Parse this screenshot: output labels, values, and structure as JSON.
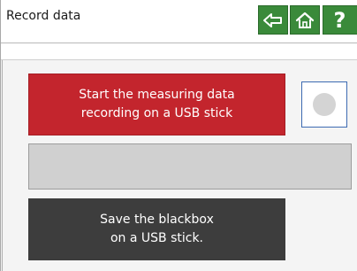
{
  "header": {
    "title": "Record data",
    "back_icon": "arrow-left-icon",
    "home_icon": "home-icon",
    "help_label": "?"
  },
  "actions": {
    "record_label": "Start the measuring data\nrecording on a USB stick",
    "blackbox_label": "Save the blackbox\non a USB stick."
  },
  "colors": {
    "nav_green": "#3a8a3a",
    "record_red": "#c3252d",
    "blackbox_dark": "#3d3d3d",
    "status_border": "#3d6bb2"
  }
}
